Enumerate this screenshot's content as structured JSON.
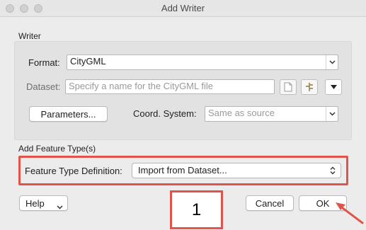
{
  "window": {
    "title": "Add Writer"
  },
  "writer": {
    "section_label": "Writer",
    "format_label": "Format:",
    "format_value": "CityGML",
    "dataset_label": "Dataset:",
    "dataset_placeholder": "Specify a name for the CityGML file",
    "parameters_button": "Parameters...",
    "coord_system_label": "Coord. System:",
    "coord_system_value": "Same as source"
  },
  "feature_type": {
    "section_label": "Add Feature Type(s)",
    "definition_label": "Feature Type Definition:",
    "definition_value": "Import from Dataset..."
  },
  "footer": {
    "help_label": "Help",
    "cancel_label": "Cancel",
    "ok_label": "OK"
  },
  "annotations": {
    "step_number": "1",
    "accent_color": "#e0554b"
  },
  "icons": [
    "window-close-icon",
    "window-minimize-icon",
    "window-zoom-icon",
    "chevron-down-icon",
    "file-icon",
    "tree-icon",
    "triangle-down-icon",
    "up-down-chevron-icon",
    "arrow-icon"
  ]
}
